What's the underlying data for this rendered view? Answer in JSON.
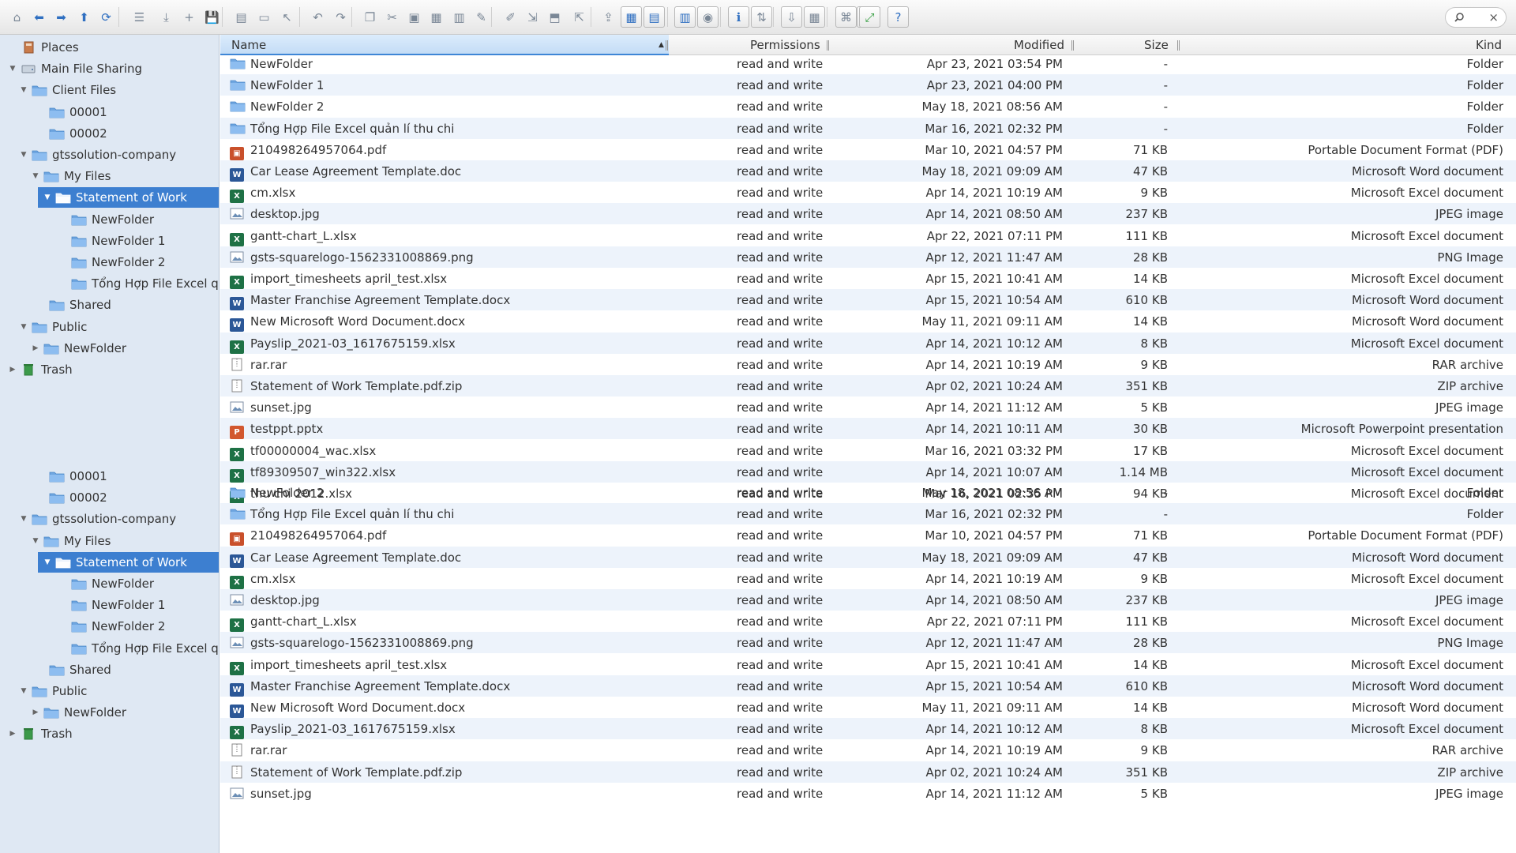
{
  "toolbar": {
    "buttons": [
      "home-icon",
      "back-icon",
      "forward-icon",
      "up-icon",
      "reload-icon",
      "view-icon",
      "download-icon",
      "new-file-icon",
      "save-icon",
      "open-icon",
      "disk-icon",
      "select-icon",
      "undo-icon",
      "redo-icon",
      "copy-icon",
      "cut-icon",
      "paste-icon",
      "delete-icon",
      "duplicate-icon",
      "rename-icon",
      "edit-icon",
      "extract-icon",
      "archive-icon",
      "resize-icon",
      "share-icon",
      "icons-view-icon",
      "list-view-icon",
      "columns-view-icon",
      "preview-icon",
      "info-icon",
      "sort-icon",
      "filter-icon",
      "grid-icon",
      "netmount-icon",
      "settings-icon",
      "help-icon",
      "fullscreen-icon"
    ],
    "search_placeholder": "",
    "search_clear": "×"
  },
  "sidebar": {
    "tree": [
      {
        "label": "Places",
        "icon": "places-icon",
        "twisty": "",
        "selected": false
      },
      {
        "label": "Main File Sharing",
        "icon": "drive-icon",
        "twisty": "▼",
        "selected": false
      },
      {
        "label": "Client Files",
        "icon": "folder-icon",
        "twisty": "▼",
        "selected": false
      },
      {
        "label": "00001",
        "icon": "folder-icon",
        "twisty": "",
        "selected": false
      },
      {
        "label": "00002",
        "icon": "folder-icon",
        "twisty": "",
        "selected": false
      },
      {
        "label": "gtssolution-company",
        "icon": "folder-icon",
        "twisty": "▼",
        "selected": false
      },
      {
        "label": "My Files",
        "icon": "folder-icon",
        "twisty": "▼",
        "selected": false
      },
      {
        "label": "Statement of Work",
        "icon": "folder-open-icon",
        "twisty": "▼",
        "selected": true
      },
      {
        "label": "NewFolder",
        "icon": "folder-icon",
        "twisty": "",
        "selected": false
      },
      {
        "label": "NewFolder 1",
        "icon": "folder-icon",
        "twisty": "",
        "selected": false
      },
      {
        "label": "NewFolder 2",
        "icon": "folder-icon",
        "twisty": "",
        "selected": false
      },
      {
        "label": "Tổng Hợp File Excel quả",
        "icon": "folder-icon",
        "twisty": "",
        "selected": false
      },
      {
        "label": "Shared",
        "icon": "folder-icon",
        "twisty": "",
        "selected": false
      },
      {
        "label": "Public",
        "icon": "folder-icon",
        "twisty": "▼",
        "selected": false
      },
      {
        "label": "NewFolder",
        "icon": "folder-icon",
        "twisty": "▶",
        "selected": false
      },
      {
        "label": "Trash",
        "icon": "trash-icon",
        "twisty": "▶",
        "selected": false
      }
    ],
    "tree_repeat": [
      {
        "label": "00001",
        "icon": "folder-icon",
        "twisty": "",
        "selected": false
      },
      {
        "label": "00002",
        "icon": "folder-icon",
        "twisty": "",
        "selected": false
      },
      {
        "label": "gtssolution-company",
        "icon": "folder-icon",
        "twisty": "▼",
        "selected": false
      },
      {
        "label": "My Files",
        "icon": "folder-icon",
        "twisty": "▼",
        "selected": false
      },
      {
        "label": "Statement of Work",
        "icon": "folder-open-icon",
        "twisty": "▼",
        "selected": true
      },
      {
        "label": "NewFolder",
        "icon": "folder-icon",
        "twisty": "",
        "selected": false
      },
      {
        "label": "NewFolder 1",
        "icon": "folder-icon",
        "twisty": "",
        "selected": false
      },
      {
        "label": "NewFolder 2",
        "icon": "folder-icon",
        "twisty": "",
        "selected": false
      },
      {
        "label": "Tổng Hợp File Excel quả",
        "icon": "folder-icon",
        "twisty": "",
        "selected": false
      },
      {
        "label": "Shared",
        "icon": "folder-icon",
        "twisty": "",
        "selected": false
      },
      {
        "label": "Public",
        "icon": "folder-icon",
        "twisty": "▼",
        "selected": false
      },
      {
        "label": "NewFolder",
        "icon": "folder-icon",
        "twisty": "▶",
        "selected": false
      },
      {
        "label": "Trash",
        "icon": "trash-icon",
        "twisty": "▶",
        "selected": false
      }
    ]
  },
  "columns": {
    "name": "Name",
    "permissions": "Permissions",
    "modified": "Modified",
    "size": "Size",
    "kind": "Kind",
    "sort_indicator": "▲"
  },
  "files": [
    {
      "name": "NewFolder",
      "type": "folder",
      "perm": "read and write",
      "mod": "Apr 23, 2021 03:54 PM",
      "size": "-",
      "kind": "Folder"
    },
    {
      "name": "NewFolder 1",
      "type": "folder",
      "perm": "read and write",
      "mod": "Apr 23, 2021 04:00 PM",
      "size": "-",
      "kind": "Folder"
    },
    {
      "name": "NewFolder 2",
      "type": "folder",
      "perm": "read and write",
      "mod": "May 18, 2021 08:56 AM",
      "size": "-",
      "kind": "Folder"
    },
    {
      "name": "Tổng Hợp File Excel quản lí thu chi",
      "type": "folder",
      "perm": "read and write",
      "mod": "Mar 16, 2021 02:32 PM",
      "size": "-",
      "kind": "Folder"
    },
    {
      "name": "210498264957064.pdf",
      "type": "pdf",
      "perm": "read and write",
      "mod": "Mar 10, 2021 04:57 PM",
      "size": "71 KB",
      "kind": "Portable Document Format (PDF)"
    },
    {
      "name": "Car Lease Agreement Template.doc",
      "type": "word",
      "perm": "read and write",
      "mod": "May 18, 2021 09:09 AM",
      "size": "47 KB",
      "kind": "Microsoft Word document"
    },
    {
      "name": "cm.xlsx",
      "type": "excel",
      "perm": "read and write",
      "mod": "Apr 14, 2021 10:19 AM",
      "size": "9 KB",
      "kind": "Microsoft Excel document"
    },
    {
      "name": "desktop.jpg",
      "type": "image",
      "perm": "read and write",
      "mod": "Apr 14, 2021 08:50 AM",
      "size": "237 KB",
      "kind": "JPEG image"
    },
    {
      "name": "gantt-chart_L.xlsx",
      "type": "excel",
      "perm": "read and write",
      "mod": "Apr 22, 2021 07:11 PM",
      "size": "111 KB",
      "kind": "Microsoft Excel document"
    },
    {
      "name": "gsts-squarelogo-1562331008869.png",
      "type": "image",
      "perm": "read and write",
      "mod": "Apr 12, 2021 11:47 AM",
      "size": "28 KB",
      "kind": "PNG Image"
    },
    {
      "name": "import_timesheets april_test.xlsx",
      "type": "excel",
      "perm": "read and write",
      "mod": "Apr 15, 2021 10:41 AM",
      "size": "14 KB",
      "kind": "Microsoft Excel document"
    },
    {
      "name": "Master Franchise Agreement Template.docx",
      "type": "word",
      "perm": "read and write",
      "mod": "Apr 15, 2021 10:54 AM",
      "size": "610 KB",
      "kind": "Microsoft Word document"
    },
    {
      "name": "New Microsoft Word Document.docx",
      "type": "word",
      "perm": "read and write",
      "mod": "May 11, 2021 09:11 AM",
      "size": "14 KB",
      "kind": "Microsoft Word document"
    },
    {
      "name": "Payslip_2021-03_1617675159.xlsx",
      "type": "excel",
      "perm": "read and write",
      "mod": "Apr 14, 2021 10:12 AM",
      "size": "8 KB",
      "kind": "Microsoft Excel document"
    },
    {
      "name": "rar.rar",
      "type": "archive",
      "perm": "read and write",
      "mod": "Apr 14, 2021 10:19 AM",
      "size": "9 KB",
      "kind": "RAR archive"
    },
    {
      "name": "Statement of Work Template.pdf.zip",
      "type": "archive",
      "perm": "read and write",
      "mod": "Apr 02, 2021 10:24 AM",
      "size": "351 KB",
      "kind": "ZIP archive"
    },
    {
      "name": "sunset.jpg",
      "type": "image",
      "perm": "read and write",
      "mod": "Apr 14, 2021 11:12 AM",
      "size": "5 KB",
      "kind": "JPEG image"
    },
    {
      "name": "testppt.pptx",
      "type": "ppt",
      "perm": "read and write",
      "mod": "Apr 14, 2021 10:11 AM",
      "size": "30 KB",
      "kind": "Microsoft Powerpoint presentation"
    },
    {
      "name": "tf00000004_wac.xlsx",
      "type": "excel",
      "perm": "read and write",
      "mod": "Mar 16, 2021 03:32 PM",
      "size": "17 KB",
      "kind": "Microsoft Excel document"
    },
    {
      "name": "tf89309507_win322.xlsx",
      "type": "excel",
      "perm": "read and write",
      "mod": "Apr 14, 2021 10:07 AM",
      "size": "1.14 MB",
      "kind": "Microsoft Excel document"
    },
    {
      "name": "thu chi 2012.xlsx",
      "type": "excel",
      "perm": "read and write",
      "mod": "Mar 16, 2021 02:35 PM",
      "size": "94 KB",
      "kind": "Microsoft Excel document"
    }
  ],
  "files_repeat": [
    {
      "name": "NewFolder 2",
      "type": "folder",
      "perm": "read and write",
      "mod": "May 18, 2021 08:56 AM",
      "size": "-",
      "kind": "Folder"
    },
    {
      "name": "Tổng Hợp File Excel quản lí thu chi",
      "type": "folder",
      "perm": "read and write",
      "mod": "Mar 16, 2021 02:32 PM",
      "size": "-",
      "kind": "Folder"
    },
    {
      "name": "210498264957064.pdf",
      "type": "pdf",
      "perm": "read and write",
      "mod": "Mar 10, 2021 04:57 PM",
      "size": "71 KB",
      "kind": "Portable Document Format (PDF)"
    },
    {
      "name": "Car Lease Agreement Template.doc",
      "type": "word",
      "perm": "read and write",
      "mod": "May 18, 2021 09:09 AM",
      "size": "47 KB",
      "kind": "Microsoft Word document"
    },
    {
      "name": "cm.xlsx",
      "type": "excel",
      "perm": "read and write",
      "mod": "Apr 14, 2021 10:19 AM",
      "size": "9 KB",
      "kind": "Microsoft Excel document"
    },
    {
      "name": "desktop.jpg",
      "type": "image",
      "perm": "read and write",
      "mod": "Apr 14, 2021 08:50 AM",
      "size": "237 KB",
      "kind": "JPEG image"
    },
    {
      "name": "gantt-chart_L.xlsx",
      "type": "excel",
      "perm": "read and write",
      "mod": "Apr 22, 2021 07:11 PM",
      "size": "111 KB",
      "kind": "Microsoft Excel document"
    },
    {
      "name": "gsts-squarelogo-1562331008869.png",
      "type": "image",
      "perm": "read and write",
      "mod": "Apr 12, 2021 11:47 AM",
      "size": "28 KB",
      "kind": "PNG Image"
    },
    {
      "name": "import_timesheets april_test.xlsx",
      "type": "excel",
      "perm": "read and write",
      "mod": "Apr 15, 2021 10:41 AM",
      "size": "14 KB",
      "kind": "Microsoft Excel document"
    },
    {
      "name": "Master Franchise Agreement Template.docx",
      "type": "word",
      "perm": "read and write",
      "mod": "Apr 15, 2021 10:54 AM",
      "size": "610 KB",
      "kind": "Microsoft Word document"
    },
    {
      "name": "New Microsoft Word Document.docx",
      "type": "word",
      "perm": "read and write",
      "mod": "May 11, 2021 09:11 AM",
      "size": "14 KB",
      "kind": "Microsoft Word document"
    },
    {
      "name": "Payslip_2021-03_1617675159.xlsx",
      "type": "excel",
      "perm": "read and write",
      "mod": "Apr 14, 2021 10:12 AM",
      "size": "8 KB",
      "kind": "Microsoft Excel document"
    },
    {
      "name": "rar.rar",
      "type": "archive",
      "perm": "read and write",
      "mod": "Apr 14, 2021 10:19 AM",
      "size": "9 KB",
      "kind": "RAR archive"
    },
    {
      "name": "Statement of Work Template.pdf.zip",
      "type": "archive",
      "perm": "read and write",
      "mod": "Apr 02, 2021 10:24 AM",
      "size": "351 KB",
      "kind": "ZIP archive"
    },
    {
      "name": "sunset.jpg",
      "type": "image",
      "perm": "read and write",
      "mod": "Apr 14, 2021 11:12 AM",
      "size": "5 KB",
      "kind": "JPEG image"
    }
  ],
  "colors": {
    "accent": "#3d7fd0",
    "sidebar_bg": "#dfe8f3",
    "alt_row": "#edf3fb",
    "folder": "#6fa6e0",
    "word": "#2b5797",
    "excel": "#1e7145",
    "pdf": "#c9502b",
    "ppt": "#d2572e"
  }
}
